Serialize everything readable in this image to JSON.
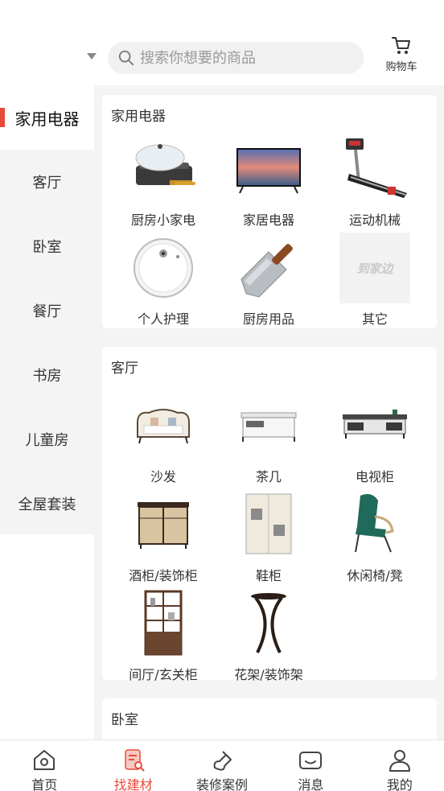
{
  "header": {
    "search_placeholder": "搜索你想要的商品",
    "cart_label": "购物车"
  },
  "sidebar": {
    "items": [
      {
        "label": "家用电器",
        "active": true
      },
      {
        "label": "客厅"
      },
      {
        "label": "卧室"
      },
      {
        "label": "餐厅"
      },
      {
        "label": "书房"
      },
      {
        "label": "儿童房"
      },
      {
        "label": "全屋套装"
      }
    ]
  },
  "sections": [
    {
      "title": "家用电器",
      "items": [
        {
          "label": "厨房小家电",
          "icon": "electric-grill-icon"
        },
        {
          "label": "家居电器",
          "icon": "television-icon"
        },
        {
          "label": "运动机械",
          "icon": "treadmill-icon"
        },
        {
          "label": "个人护理",
          "icon": "robot-vacuum-icon"
        },
        {
          "label": "厨房用品",
          "icon": "cleaver-knife-icon"
        },
        {
          "label": "其它",
          "icon": "placeholder-logo-icon",
          "logo_text": "到家边"
        }
      ]
    },
    {
      "title": "客厅",
      "items": [
        {
          "label": "沙发",
          "icon": "sofa-icon"
        },
        {
          "label": "茶几",
          "icon": "coffee-table-icon"
        },
        {
          "label": "电视柜",
          "icon": "tv-cabinet-icon"
        },
        {
          "label": "酒柜/装饰柜",
          "icon": "wine-cabinet-icon"
        },
        {
          "label": "鞋柜",
          "icon": "shoe-cabinet-icon"
        },
        {
          "label": "休闲椅/凳",
          "icon": "lounge-chair-icon"
        },
        {
          "label": "间厅/玄关柜",
          "icon": "partition-shelf-icon"
        },
        {
          "label": "花架/装饰架",
          "icon": "plant-stand-icon"
        }
      ]
    },
    {
      "title": "卧室"
    }
  ],
  "bottom_nav": [
    {
      "label": "首页",
      "icon": "home-icon"
    },
    {
      "label": "找建材",
      "icon": "find-materials-icon",
      "active": true
    },
    {
      "label": "装修案例",
      "icon": "decoration-cases-icon"
    },
    {
      "label": "消息",
      "icon": "message-icon"
    },
    {
      "label": "我的",
      "icon": "profile-icon"
    }
  ],
  "colors": {
    "accent": "#e84a3a",
    "background": "#f4f4f4"
  }
}
